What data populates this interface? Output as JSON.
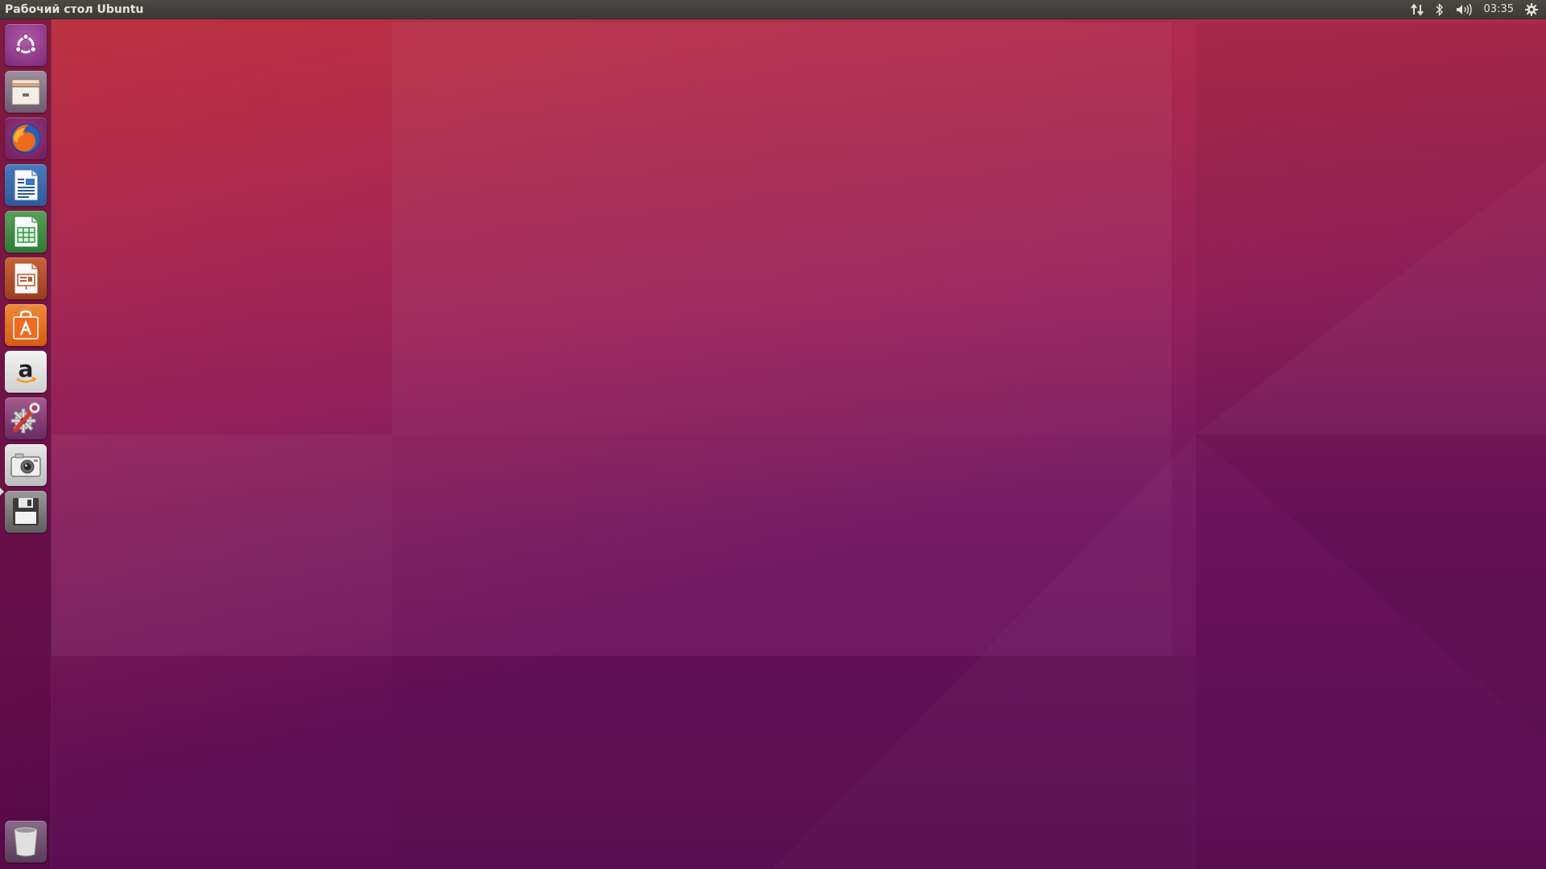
{
  "top_panel": {
    "title": "Рабочий стол Ubuntu",
    "indicators": {
      "network": "network-updown-icon",
      "bluetooth": "bluetooth-icon",
      "sound": "speaker-volume-icon",
      "clock": "03:35",
      "session": "gear-icon"
    }
  },
  "launcher": {
    "items": [
      {
        "name": "dash",
        "icon": "ubuntu-logo-icon"
      },
      {
        "name": "files",
        "icon": "file-cabinet-icon"
      },
      {
        "name": "firefox",
        "icon": "firefox-icon"
      },
      {
        "name": "libreoffice-writer",
        "icon": "writer-document-icon"
      },
      {
        "name": "libreoffice-calc",
        "icon": "calc-spreadsheet-icon"
      },
      {
        "name": "libreoffice-impress",
        "icon": "impress-presentation-icon"
      },
      {
        "name": "software-center",
        "icon": "shopping-bag-icon"
      },
      {
        "name": "amazon",
        "icon": "amazon-icon"
      },
      {
        "name": "system-settings",
        "icon": "settings-wrench-icon"
      },
      {
        "name": "screenshot",
        "icon": "camera-icon"
      },
      {
        "name": "storage",
        "icon": "floppy-disk-icon"
      },
      {
        "name": "trash",
        "icon": "trash-icon"
      }
    ],
    "active_item": "screenshot"
  },
  "colors": {
    "panel": "#3c3b37",
    "ubuntu_orange": "#e95420",
    "wallpaper_top": "#a8284f",
    "wallpaper_bottom": "#5e0f55"
  }
}
